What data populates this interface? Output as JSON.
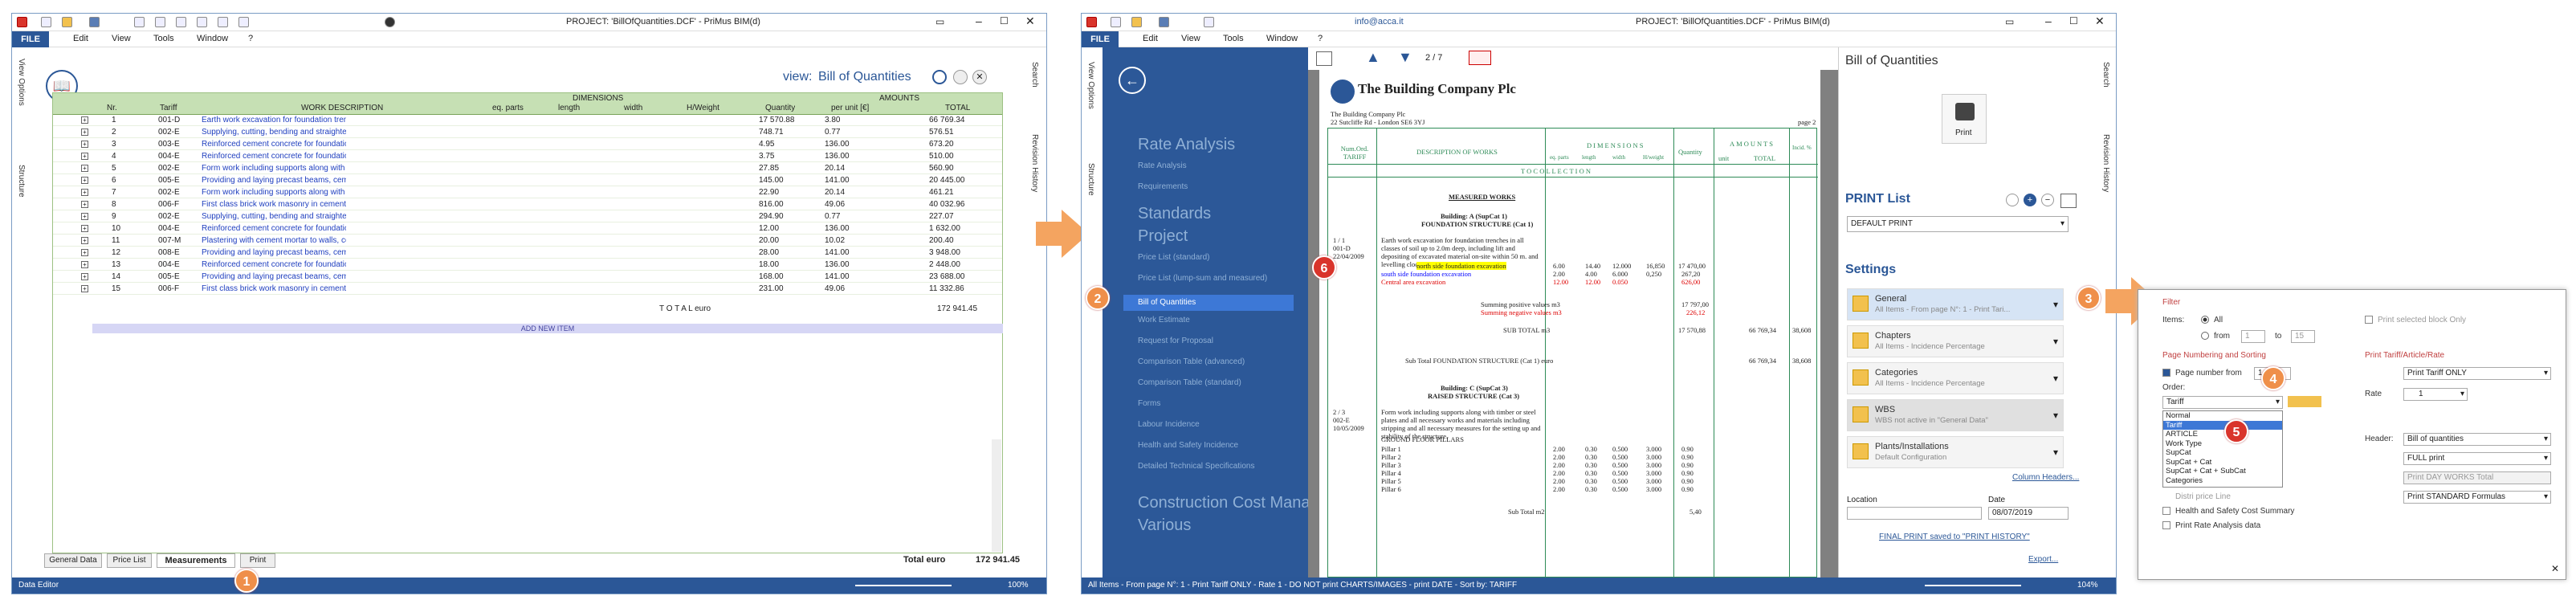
{
  "win1": {
    "title": "PROJECT: 'BillOfQuantities.DCF' - PriMus    BIM(d)",
    "menu": [
      "FILE",
      "Edit",
      "View",
      "Tools",
      "Window",
      "?"
    ],
    "view_prefix": "view:",
    "view_name": "Bill of Quantities",
    "side_tabs_left": [
      "View Options",
      "Structure"
    ],
    "side_tabs_right": [
      "Search",
      "Revision History"
    ],
    "table": {
      "headers": [
        "Nr.",
        "Tariff",
        "WORK DESCRIPTION",
        "DIMENSIONS",
        "eq. parts",
        "length",
        "width",
        "H/Weight",
        "Quantity",
        "AMOUNTS",
        "per unit [€]",
        "TOTAL"
      ],
      "rows": [
        [
          "1",
          "001-D",
          "Earth work excavation for foundation trenches in all classes of",
          "17 570.88",
          "3.80",
          "66 769.34"
        ],
        [
          "2",
          "002-E",
          "Supplying, cutting, bending and straightening reinforcement f",
          "748.71",
          "0.77",
          "576.51"
        ],
        [
          "3",
          "003-E",
          "Reinforced cement concrete for foundation beams, using 30m",
          "4.95",
          "136.00",
          "673.20"
        ],
        [
          "4",
          "004-E",
          "Reinforced cement concrete for foundation beams, using 30m",
          "3.75",
          "136.00",
          "510.00"
        ],
        [
          "5",
          "002-E",
          "Form work including supports along with timber or steel plates",
          "27.85",
          "20.14",
          "560.90"
        ],
        [
          "6",
          "005-E",
          "Providing and laying precast beams, cement casting and all ne",
          "145.00",
          "141.00",
          "20 445.00"
        ],
        [
          "7",
          "002-E",
          "Form work including supports along with timber or steel plates",
          "22.90",
          "20.14",
          "461.21"
        ],
        [
          "8",
          "006-F",
          "First class brick work masonry in cement mortar 1:6 (1 cement",
          "816.00",
          "49.06",
          "40 032.96"
        ],
        [
          "9",
          "002-E",
          "Supplying, cutting, bending and straightening reinforcement f",
          "294.90",
          "0.77",
          "227.07"
        ],
        [
          "10",
          "004-E",
          "Reinforced cement concrete for foundation beams, using 30m",
          "12.00",
          "136.00",
          "1 632.00"
        ],
        [
          "11",
          "007-M",
          "Plastering with cement mortar to walls, columns and other stru",
          "20.00",
          "10.02",
          "200.40"
        ],
        [
          "12",
          "008-E",
          "Providing and laying precast beams, cement casting and all ne",
          "28.00",
          "141.00",
          "3 948.00"
        ],
        [
          "13",
          "004-E",
          "Reinforced cement concrete for foundation beams, using 30m",
          "18.00",
          "136.00",
          "2 448.00"
        ],
        [
          "14",
          "005-E",
          "Providing and laying precast beams, cement casting and all ne",
          "168.00",
          "141.00",
          "23 688.00"
        ],
        [
          "15",
          "006-F",
          "First class brick work masonry in cement mortar 1:6 (1 cement",
          "231.00",
          "49.06",
          "11 332.86"
        ]
      ],
      "total_label": "T O T A L   euro",
      "total_value": "172 941.45",
      "add_new": "ADD NEW ITEM"
    },
    "bottom_tabs": [
      "General Data",
      "Price List",
      "Measurements",
      "Print"
    ],
    "footer_total_label": "Total  euro",
    "footer_total_value": "172 941.45",
    "status_left": "Data Editor",
    "status_zoom": "100%"
  },
  "win2": {
    "title": "PROJECT: 'BillOfQuantities.DCF' - PriMus    BIM(d)",
    "email": "info@acca.it",
    "menu": [
      "FILE",
      "Edit",
      "View",
      "Tools",
      "Window",
      "?"
    ],
    "page_counter": "2 / 7",
    "nav": {
      "rate_analysis": "Rate Analysis",
      "rate_items": [
        "Rate Analysis",
        "Requirements"
      ],
      "standards": "Standards",
      "project": "Project",
      "project_items": [
        "Price List (standard)",
        "Price List (lump-sum and measured)",
        "Bill of Quantities",
        "Work Estimate",
        "Request for Proposal",
        "Comparison Table (advanced)",
        "Comparison Table (standard)",
        "Forms",
        "Labour Incidence",
        "Health and Safety Incidence",
        "Detailed Technical Specifications"
      ],
      "construction": "Construction Cost Manag",
      "various": "Various"
    },
    "doc": {
      "company": "The Building Company Plc",
      "address1": "The Building Company Plc",
      "address2": "22 Sutcliffe Rd - London SE6 3YJ",
      "page": "page 2",
      "col_num": "Num.Ord. TARIFF",
      "col_desc": "DESCRIPTION OF WORKS",
      "col_dims": "DIMENSIONS",
      "col_dim_parts": [
        "eq. parts",
        "length",
        "width",
        "H/weight"
      ],
      "col_qty": "Quantity",
      "col_amounts": "AMOUNTS",
      "col_unit": "unit",
      "col_total": "TOTAL",
      "col_incid": "Incid. %",
      "carried": "T O   C O L L E C T I O N",
      "measured": "MEASURED WORKS",
      "building_a": "Building: A  (SupCat 1)",
      "foundation": "FOUNDATION STRUCTURE  (Cat 1)",
      "item_num": "1 / 1",
      "item_code": "001-D",
      "item_date": "22/04/2009",
      "item_desc": "Earth work excavation for foundation trenches in all classes of soil up to 2.0m deep, including lift and depositing of excavated material on-site within 50 m. and levelling clods.",
      "north_side": "north side foundation excavation",
      "south_side": "south side foundation excavation",
      "central": "Central area excavation",
      "v1": "6.00",
      "v2": "14.40",
      "v3": "12.000",
      "v4": "16,850",
      "v5": "17 470,00",
      "r2": [
        "2.00",
        "4.00",
        "6.000",
        "0,250",
        "267,20"
      ],
      "r3": [
        "12.00",
        "12.00",
        "0.050",
        "",
        "626,00"
      ],
      "sum1": "Summing positive values m3",
      "sum2": "Summing negative values m3",
      "sum_v1": "17 797,00",
      "sum_v2": "226,12",
      "subtotal": "SUB TOTAL m3",
      "subtotal_v": "17 570,88",
      "subtotal_amt": "66 769,34",
      "subtotal_pct": "38,608",
      "subfound": "Sub Total FOUNDATION STRUCTURE (Cat 1) euro",
      "subfound_amt": "66 769,34",
      "subfound_pct": "38,608",
      "building_c": "Building: C  (SupCat 3)",
      "raised": "RAISED STRUCTURE  (Cat 3)",
      "item2_num": "2 / 3",
      "item2_code": "002-E",
      "item2_date": "10/05/2009",
      "item2_desc": "Form work including supports along with timber or steel plates and all necessary works and materials including stripping and all necessary measures for the setting up and stability of the structure.",
      "ground": "GROUND FLOOR PILLARS",
      "pillars": [
        "Pillar 1",
        "Pillar 2",
        "Pillar 3",
        "Pillar 4",
        "Pillar 5",
        "Pillar 6"
      ],
      "pillar_vals": [
        "2.00",
        "0.30",
        "0.500",
        "3.000",
        "0.90"
      ],
      "subtotal2": "Sub Total m2",
      "subtotal2_v": "5,40"
    },
    "panel": {
      "title": "Bill of Quantities",
      "print_btn": "Print",
      "print_list": "PRINT List",
      "default_print": "DEFAULT PRINT",
      "settings": "Settings",
      "items": [
        {
          "title": "General",
          "sub": "All Items - From page N°: 1 - Print Tari..."
        },
        {
          "title": "Chapters",
          "sub": "All Items - Incidence Percentage"
        },
        {
          "title": "Categories",
          "sub": "All Items - Incidence Percentage"
        },
        {
          "title": "WBS",
          "sub": "WBS not active in \"General Data\""
        },
        {
          "title": "Plants/Installations",
          "sub": "Default Configuration"
        }
      ],
      "column_headers": "Column Headers...",
      "location_label": "Location",
      "date_label": "Date",
      "date_value": "08/07/2019",
      "final_print": "FINAL PRINT saved to \"PRINT HISTORY\"",
      "export": "Export..."
    },
    "side_tabs_left": [
      "View Options",
      "Structure"
    ],
    "side_tabs_right": [
      "Search",
      "Revision History"
    ],
    "status_text": "All Items - From page N°: 1 - Print Tariff ONLY - Rate 1 - DO NOT print CHARTS/IMAGES - print DATE - Sort by: TARIFF",
    "status_zoom": "104%"
  },
  "dialog": {
    "filter": "Filter",
    "items_label": "Items:",
    "all": "All",
    "from": "from",
    "to": "to",
    "from_val": "1",
    "to_val": "15",
    "print_selected": "Print selected block Only",
    "page_section": "Page Numbering and Sorting",
    "page_number_from": "Page number from",
    "page_number_val": "1",
    "order_label": "Order:",
    "order_value": "Tariff",
    "order_options": [
      "Normal",
      "Tariff",
      "ARTICLE",
      "Work Type",
      "SupCat",
      "SupCat + Cat",
      "SupCat + Cat + SubCat",
      "Categories"
    ],
    "order_selected": "Tariff",
    "under1": "Distri price Line",
    "health": "Health and Safety Cost Summary",
    "rate_data": "Print Rate Analysis data",
    "tariff_section": "Print Tariff/Article/Rate",
    "tariff_value": "Print Tariff ONLY",
    "rate_label": "Rate",
    "rate_value": "1",
    "header_label": "Header:",
    "header_value": "Bill of quantities",
    "print_values": [
      "FULL print",
      "Print DAY WORKS Total",
      "Print STANDARD Formulas"
    ]
  },
  "badges": [
    "1",
    "2",
    "3",
    "4",
    "5",
    "6"
  ],
  "colors": {
    "accent": "#2b5797",
    "grid": "#c6e0b4",
    "orange": "#f4a460",
    "nav_bg": "#2c5898",
    "dialog_red": "#c04040"
  }
}
